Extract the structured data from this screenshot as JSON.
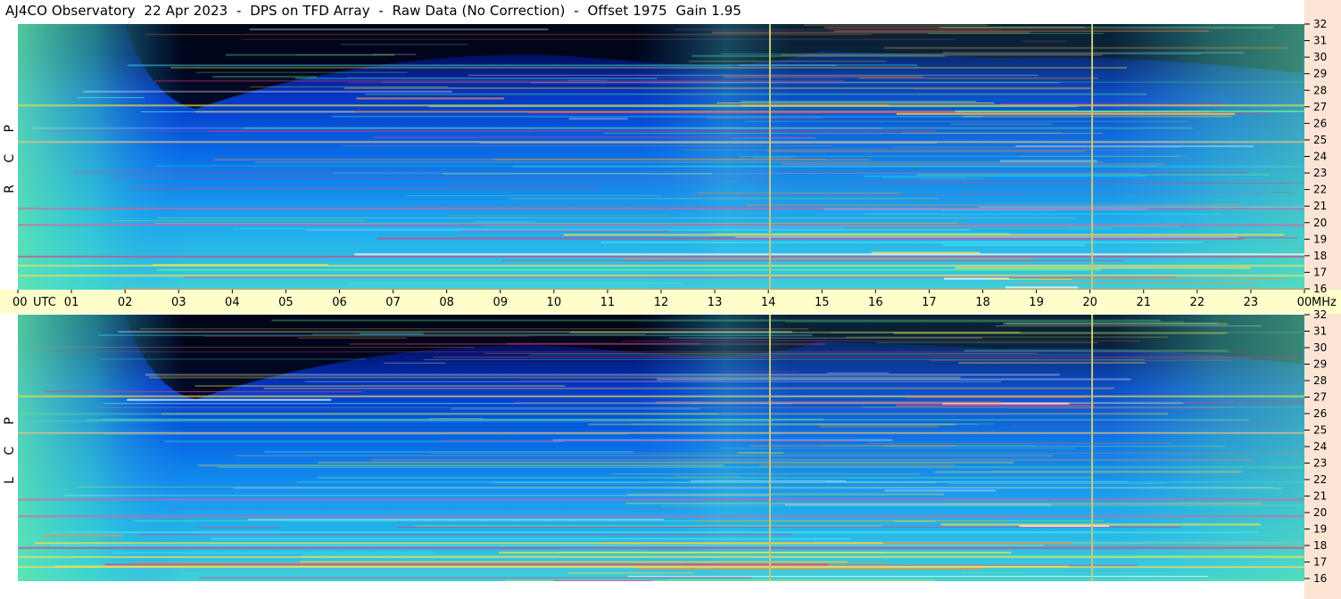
{
  "title": "AJ4CO Observatory  22 Apr 2023  -  DPS on TFD Array  -  Raw Data (No Correction)  -  Offset 1975  Gain 1.95",
  "chart_data": [
    {
      "type": "heatmap",
      "polarization": "R C P",
      "x_unit": "UTC",
      "x_ticks": [
        "00",
        "01",
        "02",
        "03",
        "04",
        "05",
        "06",
        "07",
        "08",
        "09",
        "10",
        "11",
        "12",
        "13",
        "14",
        "15",
        "16",
        "17",
        "18",
        "19",
        "20",
        "21",
        "22",
        "23",
        "00"
      ],
      "xlim": [
        0,
        24
      ],
      "y_unit": "MHz",
      "y_ticks": [
        "32",
        "31",
        "30",
        "29",
        "28",
        "27",
        "26",
        "25",
        "24",
        "23",
        "22",
        "21",
        "20",
        "19",
        "18",
        "17",
        "16"
      ],
      "ylim": [
        16,
        32
      ],
      "marker_lines_hours": [
        14.03,
        20.04
      ]
    },
    {
      "type": "heatmap",
      "polarization": "L C P",
      "x_unit": "UTC",
      "x_ticks": [
        "00",
        "01",
        "02",
        "03",
        "04",
        "05",
        "06",
        "07",
        "08",
        "09",
        "10",
        "11",
        "12",
        "13",
        "14",
        "15",
        "16",
        "17",
        "18",
        "19",
        "20",
        "21",
        "22",
        "23",
        "00"
      ],
      "xlim": [
        0,
        24
      ],
      "y_unit": "MHz",
      "y_ticks": [
        "32",
        "31",
        "30",
        "29",
        "28",
        "27",
        "26",
        "25",
        "24",
        "23",
        "22",
        "21",
        "20",
        "19",
        "18",
        "17",
        "16"
      ],
      "ylim": [
        16,
        32
      ],
      "marker_lines_hours": [
        14.03,
        20.04
      ]
    }
  ],
  "axis": {
    "utc_label": "UTC",
    "mhz_label": "MHz",
    "rcp_label": "R C P",
    "lcp_label": "L C P"
  }
}
